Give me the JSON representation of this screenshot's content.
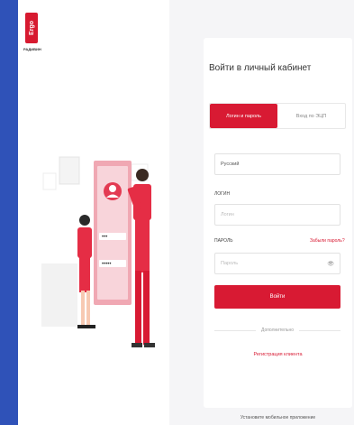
{
  "brand": {
    "logo_mark": "Ergo",
    "logo_text": "РАДИВИН",
    "accent_color": "#d81a33",
    "background_color": "#2f52b8"
  },
  "login": {
    "title": "Войти в личный кабинет",
    "tabs": [
      {
        "label": "Логин и пароль",
        "active": true
      },
      {
        "label": "Вход по ЭЦП",
        "active": false
      }
    ],
    "language": {
      "value": "Русский"
    },
    "login_field": {
      "label": "ЛОГИН",
      "placeholder": "Логин"
    },
    "password_field": {
      "label": "ПАРОЛЬ",
      "placeholder": "Пароль",
      "forgot_label": "Забыли пароль?",
      "toggle_icon": "eye-icon"
    },
    "submit_label": "Войти",
    "divider_label": "Дополнительно",
    "register_label": "Регистрация клиента"
  },
  "footer": {
    "text": "Установите мобильное приложение"
  }
}
